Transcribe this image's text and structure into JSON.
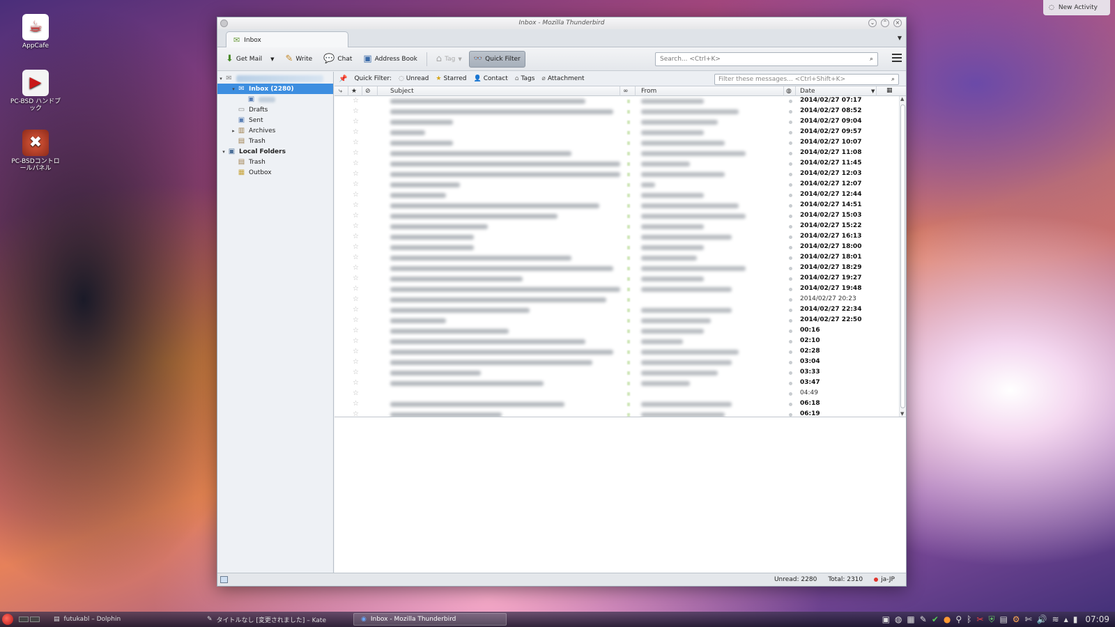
{
  "desktop": {
    "icons": [
      {
        "label": "AppCafe",
        "icon": "appcafe-icon"
      },
      {
        "label": "PC-BSD ハンドブック",
        "icon": "pdf-icon"
      },
      {
        "label": "PC-BSDコントロールパネル",
        "icon": "control-panel-icon"
      }
    ],
    "new_activity": "New Activity"
  },
  "window": {
    "title": "Inbox - Mozilla Thunderbird",
    "tab_label": "Inbox",
    "toolbar": {
      "get_mail": "Get Mail",
      "write": "Write",
      "chat": "Chat",
      "address_book": "Address Book",
      "tag": "Tag",
      "quick_filter": "Quick Filter",
      "search_placeholder": "Search... <Ctrl+K>"
    },
    "folders": [
      {
        "label": "Inbox (2280)",
        "icon": "inbox-icon",
        "level": 1,
        "twisty": "▾",
        "selected": true
      },
      {
        "label": "Drafts",
        "icon": "drafts-icon",
        "level": 1
      },
      {
        "label": "Sent",
        "icon": "sent-icon",
        "level": 1
      },
      {
        "label": "Archives",
        "icon": "archives-icon",
        "level": 1,
        "twisty": "▸"
      },
      {
        "label": "Trash",
        "icon": "trash-icon",
        "level": 1
      },
      {
        "label": "Local Folders",
        "icon": "local-folders-icon",
        "level": 0,
        "twisty": "▾"
      },
      {
        "label": "Trash",
        "icon": "trash-icon",
        "level": 1
      },
      {
        "label": "Outbox",
        "icon": "outbox-icon",
        "level": 1
      }
    ],
    "quick_filter": {
      "label": "Quick Filter:",
      "buttons": [
        "Unread",
        "Starred",
        "Contact",
        "Tags",
        "Attachment"
      ],
      "filter_placeholder": "Filter these messages... <Ctrl+Shift+K>"
    },
    "columns": {
      "subject": "Subject",
      "from": "From",
      "date": "Date"
    },
    "messages": [
      {
        "date": "2014/02/27 07:17",
        "unread": true
      },
      {
        "date": "2014/02/27 08:52",
        "unread": true
      },
      {
        "date": "2014/02/27 09:04",
        "unread": true
      },
      {
        "date": "2014/02/27 09:57",
        "unread": true
      },
      {
        "date": "2014/02/27 10:07",
        "unread": true
      },
      {
        "date": "2014/02/27 11:08",
        "unread": true
      },
      {
        "date": "2014/02/27 11:45",
        "unread": true
      },
      {
        "date": "2014/02/27 12:03",
        "unread": true
      },
      {
        "date": "2014/02/27 12:07",
        "unread": true
      },
      {
        "date": "2014/02/27 12:44",
        "unread": true
      },
      {
        "date": "2014/02/27 14:51",
        "unread": true
      },
      {
        "date": "2014/02/27 15:03",
        "unread": true
      },
      {
        "date": "2014/02/27 15:22",
        "unread": true
      },
      {
        "date": "2014/02/27 16:13",
        "unread": true
      },
      {
        "date": "2014/02/27 18:00",
        "unread": true
      },
      {
        "date": "2014/02/27 18:01",
        "unread": true
      },
      {
        "date": "2014/02/27 18:29",
        "unread": true
      },
      {
        "date": "2014/02/27 19:27",
        "unread": true
      },
      {
        "date": "2014/02/27 19:48",
        "unread": true
      },
      {
        "date": "2014/02/27 20:23",
        "unread": false
      },
      {
        "date": "2014/02/27 22:34",
        "unread": true
      },
      {
        "date": "2014/02/27 22:50",
        "unread": true
      },
      {
        "date": "00:16",
        "unread": true
      },
      {
        "date": "02:10",
        "unread": true
      },
      {
        "date": "02:28",
        "unread": true
      },
      {
        "date": "03:04",
        "unread": true
      },
      {
        "date": "03:33",
        "unread": true
      },
      {
        "date": "03:47",
        "unread": true
      },
      {
        "date": "04:49",
        "unread": false
      },
      {
        "date": "06:18",
        "unread": true
      },
      {
        "date": "06:19",
        "unread": true
      }
    ],
    "status": {
      "unread": "Unread: 2280",
      "total": "Total: 2310",
      "locale": "ja-JP"
    }
  },
  "taskbar": {
    "tasks": [
      {
        "label": "futukabl – Dolphin",
        "active": false
      },
      {
        "label": "タイトルなし [変更されました] – Kate",
        "active": false
      },
      {
        "label": "Inbox - Mozilla Thunderbird",
        "active": true
      }
    ],
    "clock": "07:09"
  }
}
